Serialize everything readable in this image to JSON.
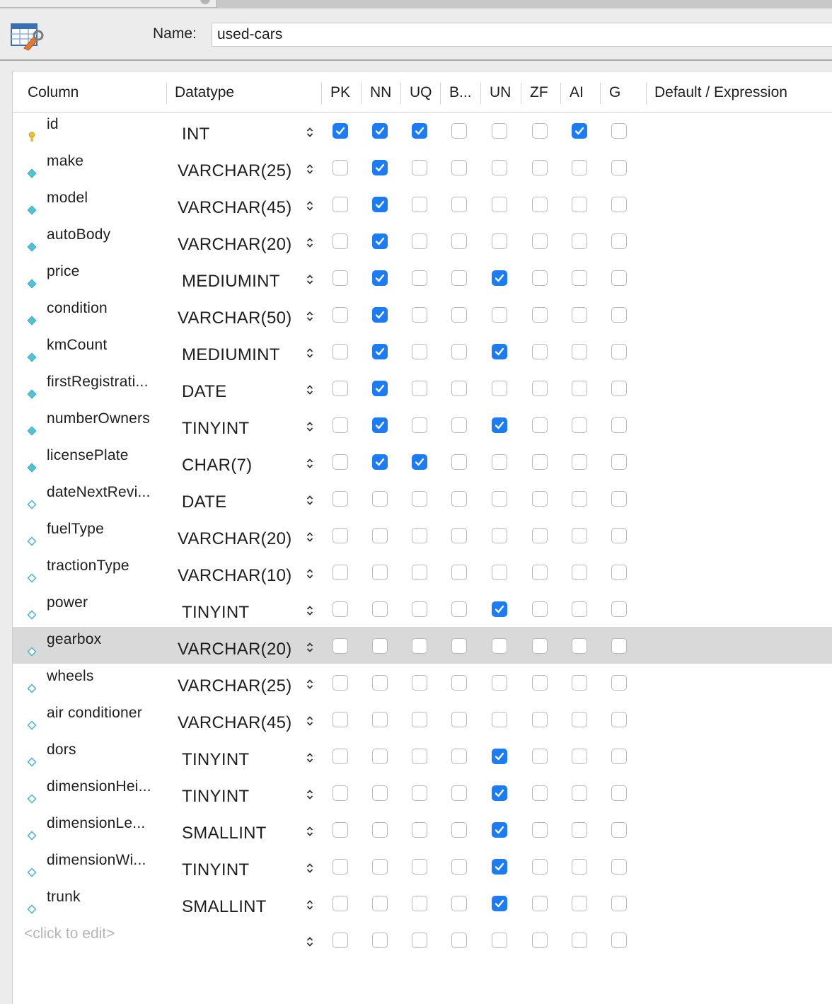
{
  "header": {
    "name_label": "Name:",
    "name_value": "used-cars",
    "icon": "table-edit-icon"
  },
  "columns_header": {
    "column": "Column",
    "datatype": "Datatype",
    "flags": [
      "PK",
      "NN",
      "UQ",
      "B...",
      "UN",
      "ZF",
      "AI",
      "G"
    ],
    "default": "Default / Expression"
  },
  "colors": {
    "checkbox_on": "#1b7cf5",
    "selected_row": "#d9d9d9",
    "key_icon": "#f3c12e",
    "nn_icon": "#4cc5d8",
    "null_icon": "#59b8cc"
  },
  "rows": [
    {
      "name": "id",
      "type": "INT",
      "icon": "primary-key-icon",
      "flags": [
        1,
        1,
        1,
        0,
        0,
        0,
        1,
        0
      ]
    },
    {
      "name": "make",
      "type": "VARCHAR(25)",
      "icon": "not-null-column-icon",
      "flags": [
        0,
        1,
        0,
        0,
        0,
        0,
        0,
        0
      ]
    },
    {
      "name": "model",
      "type": "VARCHAR(45)",
      "icon": "not-null-column-icon",
      "flags": [
        0,
        1,
        0,
        0,
        0,
        0,
        0,
        0
      ]
    },
    {
      "name": "autoBody",
      "type": "VARCHAR(20)",
      "icon": "not-null-column-icon",
      "flags": [
        0,
        1,
        0,
        0,
        0,
        0,
        0,
        0
      ]
    },
    {
      "name": "price",
      "type": "MEDIUMINT",
      "icon": "not-null-column-icon",
      "flags": [
        0,
        1,
        0,
        0,
        1,
        0,
        0,
        0
      ]
    },
    {
      "name": "condition",
      "type": "VARCHAR(50)",
      "icon": "not-null-column-icon",
      "flags": [
        0,
        1,
        0,
        0,
        0,
        0,
        0,
        0
      ]
    },
    {
      "name": "kmCount",
      "type": "MEDIUMINT",
      "icon": "not-null-column-icon",
      "flags": [
        0,
        1,
        0,
        0,
        1,
        0,
        0,
        0
      ]
    },
    {
      "name": "firstRegistrati...",
      "type": "DATE",
      "icon": "not-null-column-icon",
      "flags": [
        0,
        1,
        0,
        0,
        0,
        0,
        0,
        0
      ]
    },
    {
      "name": "numberOwners",
      "type": "TINYINT",
      "icon": "not-null-column-icon",
      "flags": [
        0,
        1,
        0,
        0,
        1,
        0,
        0,
        0
      ]
    },
    {
      "name": "licensePlate",
      "type": "CHAR(7)",
      "icon": "not-null-column-icon",
      "flags": [
        0,
        1,
        1,
        0,
        0,
        0,
        0,
        0
      ]
    },
    {
      "name": "dateNextRevi...",
      "type": "DATE",
      "icon": "nullable-column-icon",
      "flags": [
        0,
        0,
        0,
        0,
        0,
        0,
        0,
        0
      ]
    },
    {
      "name": "fuelType",
      "type": "VARCHAR(20)",
      "icon": "nullable-column-icon",
      "flags": [
        0,
        0,
        0,
        0,
        0,
        0,
        0,
        0
      ]
    },
    {
      "name": "tractionType",
      "type": "VARCHAR(10)",
      "icon": "nullable-column-icon",
      "flags": [
        0,
        0,
        0,
        0,
        0,
        0,
        0,
        0
      ]
    },
    {
      "name": "power",
      "type": "TINYINT",
      "icon": "nullable-column-icon",
      "flags": [
        0,
        0,
        0,
        0,
        1,
        0,
        0,
        0
      ]
    },
    {
      "name": "gearbox",
      "type": "VARCHAR(20)",
      "icon": "nullable-column-icon",
      "flags": [
        0,
        0,
        0,
        0,
        0,
        0,
        0,
        0
      ],
      "selected": true
    },
    {
      "name": "wheels",
      "type": "VARCHAR(25)",
      "icon": "nullable-column-icon",
      "flags": [
        0,
        0,
        0,
        0,
        0,
        0,
        0,
        0
      ]
    },
    {
      "name": "air conditioner",
      "type": "VARCHAR(45)",
      "icon": "nullable-column-icon",
      "flags": [
        0,
        0,
        0,
        0,
        0,
        0,
        0,
        0
      ]
    },
    {
      "name": "dors",
      "type": "TINYINT",
      "icon": "nullable-column-icon",
      "flags": [
        0,
        0,
        0,
        0,
        1,
        0,
        0,
        0
      ]
    },
    {
      "name": "dimensionHei...",
      "type": "TINYINT",
      "icon": "nullable-column-icon",
      "flags": [
        0,
        0,
        0,
        0,
        1,
        0,
        0,
        0
      ]
    },
    {
      "name": "dimensionLe...",
      "type": "SMALLINT",
      "icon": "nullable-column-icon",
      "flags": [
        0,
        0,
        0,
        0,
        1,
        0,
        0,
        0
      ]
    },
    {
      "name": "dimensionWi...",
      "type": "TINYINT",
      "icon": "nullable-column-icon",
      "flags": [
        0,
        0,
        0,
        0,
        1,
        0,
        0,
        0
      ]
    },
    {
      "name": "trunk",
      "type": "SMALLINT",
      "icon": "nullable-column-icon",
      "flags": [
        0,
        0,
        0,
        0,
        1,
        0,
        0,
        0
      ]
    }
  ],
  "new_row": {
    "placeholder": "<click to edit>",
    "flags": [
      0,
      0,
      0,
      0,
      0,
      0,
      0,
      0
    ]
  }
}
